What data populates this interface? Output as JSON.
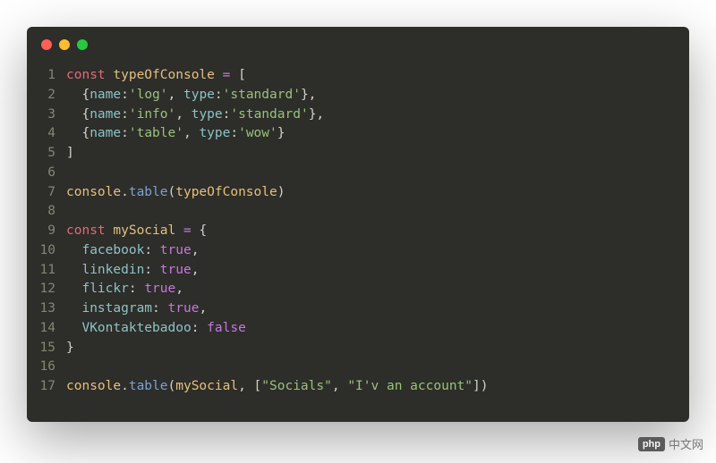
{
  "code": {
    "lines": [
      {
        "num": "1",
        "tokens": [
          {
            "t": "keyword",
            "v": "const"
          },
          {
            "t": "punct",
            "v": " "
          },
          {
            "t": "variable",
            "v": "typeOfConsole"
          },
          {
            "t": "punct",
            "v": " "
          },
          {
            "t": "operator",
            "v": "="
          },
          {
            "t": "punct",
            "v": " ["
          }
        ]
      },
      {
        "num": "2",
        "tokens": [
          {
            "t": "punct",
            "v": "  {"
          },
          {
            "t": "prop",
            "v": "name"
          },
          {
            "t": "punct",
            "v": ":"
          },
          {
            "t": "string",
            "v": "'log'"
          },
          {
            "t": "punct",
            "v": ", "
          },
          {
            "t": "prop",
            "v": "type"
          },
          {
            "t": "punct",
            "v": ":"
          },
          {
            "t": "string",
            "v": "'standard'"
          },
          {
            "t": "punct",
            "v": "},"
          }
        ]
      },
      {
        "num": "3",
        "tokens": [
          {
            "t": "punct",
            "v": "  {"
          },
          {
            "t": "prop",
            "v": "name"
          },
          {
            "t": "punct",
            "v": ":"
          },
          {
            "t": "string",
            "v": "'info'"
          },
          {
            "t": "punct",
            "v": ", "
          },
          {
            "t": "prop",
            "v": "type"
          },
          {
            "t": "punct",
            "v": ":"
          },
          {
            "t": "string",
            "v": "'standard'"
          },
          {
            "t": "punct",
            "v": "},"
          }
        ]
      },
      {
        "num": "4",
        "tokens": [
          {
            "t": "punct",
            "v": "  {"
          },
          {
            "t": "prop",
            "v": "name"
          },
          {
            "t": "punct",
            "v": ":"
          },
          {
            "t": "string",
            "v": "'table'"
          },
          {
            "t": "punct",
            "v": ", "
          },
          {
            "t": "prop",
            "v": "type"
          },
          {
            "t": "punct",
            "v": ":"
          },
          {
            "t": "string",
            "v": "'wow'"
          },
          {
            "t": "punct",
            "v": "}"
          }
        ]
      },
      {
        "num": "5",
        "tokens": [
          {
            "t": "punct",
            "v": "]"
          }
        ]
      },
      {
        "num": "6",
        "tokens": []
      },
      {
        "num": "7",
        "tokens": [
          {
            "t": "variable",
            "v": "console"
          },
          {
            "t": "punct",
            "v": "."
          },
          {
            "t": "method",
            "v": "table"
          },
          {
            "t": "punct",
            "v": "("
          },
          {
            "t": "variable",
            "v": "typeOfConsole"
          },
          {
            "t": "punct",
            "v": ")"
          }
        ]
      },
      {
        "num": "8",
        "tokens": []
      },
      {
        "num": "9",
        "tokens": [
          {
            "t": "keyword",
            "v": "const"
          },
          {
            "t": "punct",
            "v": " "
          },
          {
            "t": "variable",
            "v": "mySocial"
          },
          {
            "t": "punct",
            "v": " "
          },
          {
            "t": "operator",
            "v": "="
          },
          {
            "t": "punct",
            "v": " {"
          }
        ]
      },
      {
        "num": "10",
        "tokens": [
          {
            "t": "punct",
            "v": "  "
          },
          {
            "t": "prop",
            "v": "facebook"
          },
          {
            "t": "punct",
            "v": ": "
          },
          {
            "t": "boolean",
            "v": "true"
          },
          {
            "t": "punct",
            "v": ","
          }
        ]
      },
      {
        "num": "11",
        "tokens": [
          {
            "t": "punct",
            "v": "  "
          },
          {
            "t": "prop",
            "v": "linkedin"
          },
          {
            "t": "punct",
            "v": ": "
          },
          {
            "t": "boolean",
            "v": "true"
          },
          {
            "t": "punct",
            "v": ","
          }
        ]
      },
      {
        "num": "12",
        "tokens": [
          {
            "t": "punct",
            "v": "  "
          },
          {
            "t": "prop",
            "v": "flickr"
          },
          {
            "t": "punct",
            "v": ": "
          },
          {
            "t": "boolean",
            "v": "true"
          },
          {
            "t": "punct",
            "v": ","
          }
        ]
      },
      {
        "num": "13",
        "tokens": [
          {
            "t": "punct",
            "v": "  "
          },
          {
            "t": "prop",
            "v": "instagram"
          },
          {
            "t": "punct",
            "v": ": "
          },
          {
            "t": "boolean",
            "v": "true"
          },
          {
            "t": "punct",
            "v": ","
          }
        ]
      },
      {
        "num": "14",
        "tokens": [
          {
            "t": "punct",
            "v": "  "
          },
          {
            "t": "prop",
            "v": "VKontaktebadoo"
          },
          {
            "t": "punct",
            "v": ": "
          },
          {
            "t": "boolean",
            "v": "false"
          }
        ]
      },
      {
        "num": "15",
        "tokens": [
          {
            "t": "punct",
            "v": "}"
          }
        ]
      },
      {
        "num": "16",
        "tokens": []
      },
      {
        "num": "17",
        "tokens": [
          {
            "t": "variable",
            "v": "console"
          },
          {
            "t": "punct",
            "v": "."
          },
          {
            "t": "method",
            "v": "table"
          },
          {
            "t": "punct",
            "v": "("
          },
          {
            "t": "variable",
            "v": "mySocial"
          },
          {
            "t": "punct",
            "v": ", ["
          },
          {
            "t": "string",
            "v": "\"Socials\""
          },
          {
            "t": "punct",
            "v": ", "
          },
          {
            "t": "string",
            "v": "\"I'v an account\""
          },
          {
            "t": "punct",
            "v": "])"
          }
        ]
      }
    ]
  },
  "watermark": {
    "badge": "php",
    "text": "中文网"
  }
}
